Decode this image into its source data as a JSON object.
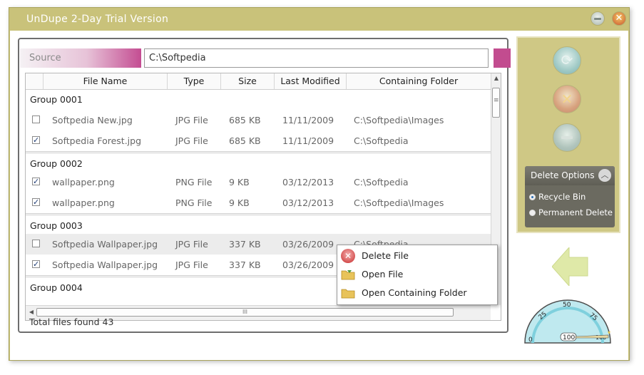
{
  "window": {
    "title": "UnDupe 2-Day Trial Version",
    "accent_color": "#c9c27a",
    "minimize_icon": "minimize-icon",
    "close_icon": "close-icon",
    "close_glyph": "✕"
  },
  "source": {
    "label": "Source",
    "path": "C:\\Softpedia",
    "accent_color": "#c24c8f"
  },
  "grid": {
    "columns": [
      "File Name",
      "Type",
      "Size",
      "Last Modified",
      "Containing Folder"
    ],
    "groups": [
      {
        "name": "Group 0001",
        "files": [
          {
            "checked": false,
            "name": "Softpedia New.jpg",
            "type": "JPG File",
            "size": "685 KB",
            "modified": "11/11/2009",
            "folder": "C:\\Softpedia\\Images"
          },
          {
            "checked": true,
            "name": "Softpedia Forest.jpg",
            "type": "JPG File",
            "size": "685 KB",
            "modified": "11/11/2009",
            "folder": "C:\\Softpedia"
          }
        ]
      },
      {
        "name": "Group 0002",
        "files": [
          {
            "checked": true,
            "name": "wallpaper.png",
            "type": "PNG File",
            "size": "9 KB",
            "modified": "03/12/2013",
            "folder": "C:\\Softpedia"
          },
          {
            "checked": true,
            "name": "wallpaper.png",
            "type": "PNG File",
            "size": "9 KB",
            "modified": "03/12/2013",
            "folder": "C:\\Softpedia\\Images"
          }
        ]
      },
      {
        "name": "Group 0003",
        "files": [
          {
            "checked": false,
            "name": "Softpedia Wallpaper.jpg",
            "type": "JPG File",
            "size": "337 KB",
            "modified": "03/26/2009",
            "folder": "C:\\Softpedia",
            "highlight": true
          },
          {
            "checked": true,
            "name": "Softpedia Wallpaper.jpg",
            "type": "JPG File",
            "size": "337 KB",
            "modified": "03/26/2009",
            "folder": ""
          }
        ]
      },
      {
        "name": "Group 0004",
        "files": []
      }
    ],
    "hscroll_grip": "III"
  },
  "status": {
    "total": "Total files found 43"
  },
  "actions": {
    "restore_icon": "restore-icon",
    "delete_icon": "delete-icon",
    "minus_icon": "minus-icon"
  },
  "delete_options": {
    "title": "Delete Options",
    "chevron": "︿",
    "options": [
      {
        "label": "Recycle Bin",
        "selected": true
      },
      {
        "label": "Permanent Delete",
        "selected": false
      }
    ]
  },
  "gauge": {
    "ticks": [
      "0",
      "25",
      "50",
      "75",
      "100"
    ],
    "readout": "100",
    "value": 100
  },
  "context_menu": {
    "items": [
      {
        "label": "Delete File",
        "icon": "delete-file-icon"
      },
      {
        "label": "Open File",
        "icon": "open-file-icon"
      },
      {
        "label": "Open Containing Folder",
        "icon": "folder-icon"
      }
    ]
  }
}
